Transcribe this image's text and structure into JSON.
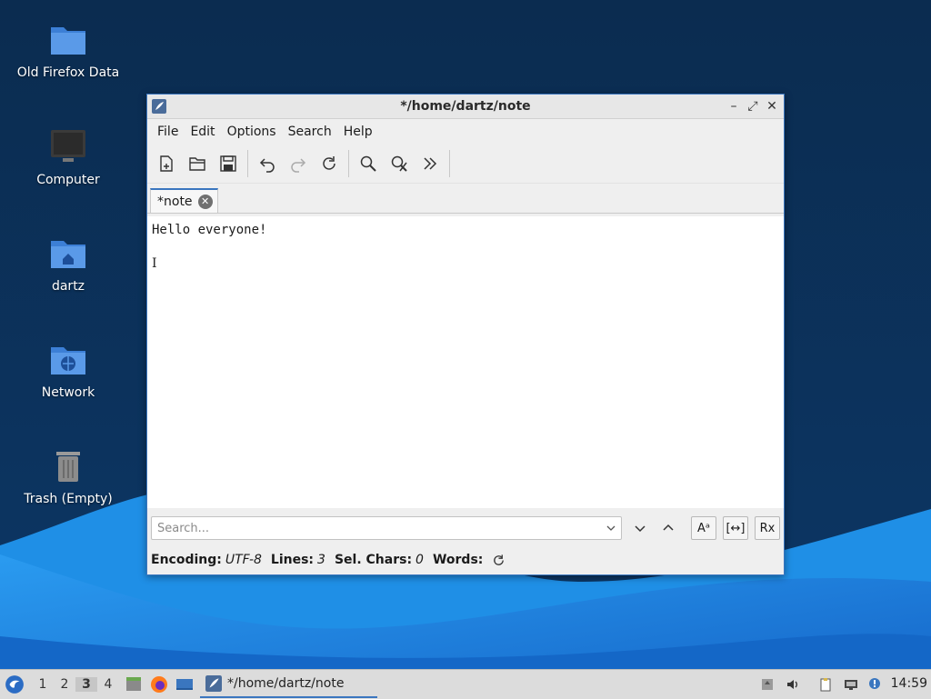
{
  "desktop": {
    "icons": [
      {
        "label": "Old Firefox Data",
        "icon": "folder-icon"
      },
      {
        "label": "Computer",
        "icon": "computer-icon"
      },
      {
        "label": "dartz",
        "icon": "home-folder-icon"
      },
      {
        "label": "Network",
        "icon": "network-folder-icon"
      },
      {
        "label": "Trash (Empty)",
        "icon": "trash-icon"
      }
    ]
  },
  "window": {
    "title": "*/home/dartz/note",
    "controls": {
      "minimize": "–",
      "maximize": "⤢",
      "close": "✕"
    },
    "menu": [
      "File",
      "Edit",
      "Options",
      "Search",
      "Help"
    ],
    "toolbar": [
      "new-file-icon",
      "open-folder-icon",
      "save-icon",
      "undo-icon",
      "redo-icon",
      "reload-icon",
      "find-icon",
      "replace-icon",
      "more-icon"
    ],
    "tab": {
      "label": "*note",
      "close": "✕"
    },
    "editor": {
      "lines": [
        "Hello everyone!",
        ""
      ],
      "caret": "I"
    },
    "search": {
      "placeholder": "Search..."
    },
    "search_buttons": {
      "match_case": "Aᵃ",
      "whole_word": "[↔]",
      "regex": "Rx"
    },
    "status": {
      "encoding_label": "Encoding:",
      "encoding_value": "UTF-8",
      "lines_label": "Lines:",
      "lines_value": "3",
      "sel_label": "Sel. Chars:",
      "sel_value": "0",
      "words_label": "Words:"
    }
  },
  "taskbar": {
    "workspaces": [
      "1",
      "2",
      "3",
      "4"
    ],
    "active_workspace": "3",
    "task_label": "*/home/dartz/note",
    "clock": "14:59"
  },
  "colors": {
    "accent": "#3a76bf",
    "desktop_dark": "#0a2d55",
    "wave_blue": "#1a7de0"
  }
}
